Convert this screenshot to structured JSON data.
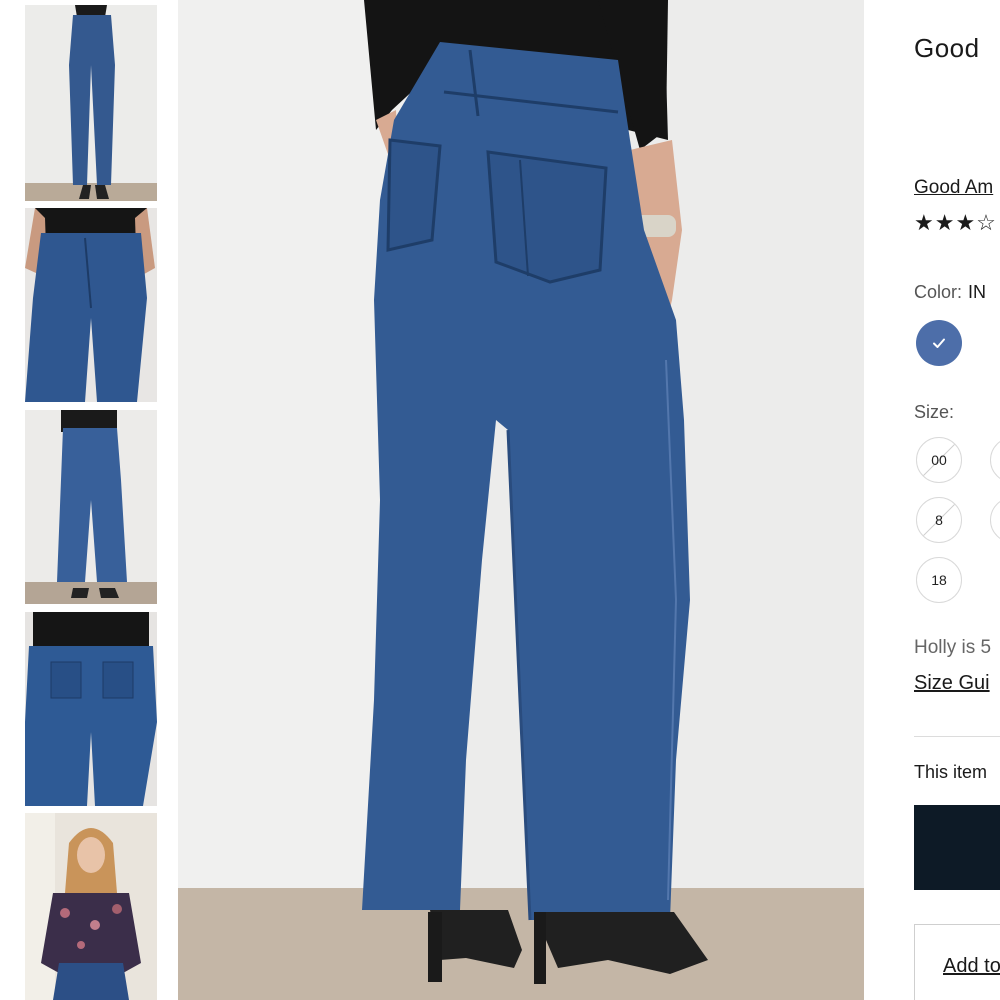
{
  "product": {
    "title": "Good",
    "brand_link": "Good Am",
    "rating_stars": "★★★☆",
    "color_label": "Color:",
    "color_value": "IN",
    "color_swatch": "#4d6ea9",
    "size_label": "Size:",
    "sizes": [
      "00",
      "8",
      "18"
    ],
    "model_info": "Holly is 5",
    "size_guide_link": "Size Gui",
    "item_note": "This item",
    "add_to_cart_color": "#0d1a26",
    "wishlist_link": "Add to"
  },
  "gallery": {
    "thumbnails": [
      "jeans-front-full",
      "jeans-front-closeup",
      "jeans-back-full",
      "jeans-back-closeup",
      "lifestyle-floral-blouse"
    ],
    "main_image": "jeans-back-view"
  }
}
